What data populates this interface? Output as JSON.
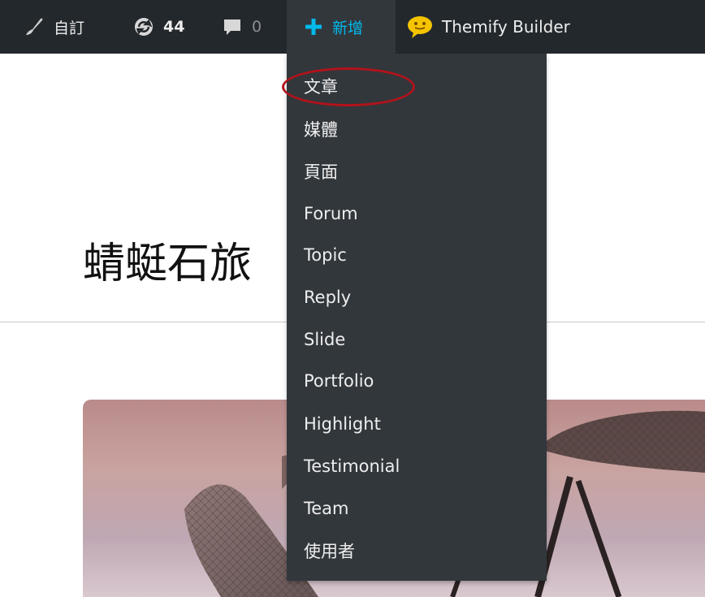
{
  "admin_bar": {
    "customize": {
      "label": "自訂",
      "icon": "paintbrush-icon"
    },
    "updates": {
      "count": "44",
      "icon": "updates-icon"
    },
    "comments": {
      "count": "0",
      "icon": "comment-icon"
    },
    "new": {
      "label": "新增",
      "icon": "plus-icon"
    },
    "themify": {
      "label": "Themify Builder",
      "icon": "themify-icon"
    }
  },
  "dropdown": {
    "items": [
      "文章",
      "媒體",
      "頁面",
      "Forum",
      "Topic",
      "Reply",
      "Slide",
      "Portfolio",
      "Highlight",
      "Testimonial",
      "Team",
      "使用者"
    ]
  },
  "page": {
    "title": "蜻蜓石旅",
    "hero_image": "dragonfly-image"
  },
  "colors": {
    "admin_bg": "#23282d",
    "submenu_bg": "#32373c",
    "accent_blue": "#00b9eb",
    "highlight_ring": "#b3121a"
  }
}
